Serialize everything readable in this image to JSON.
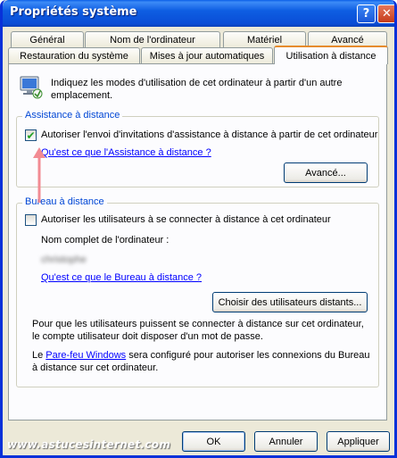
{
  "window": {
    "title": "Propriétés système",
    "help_label": "?",
    "close_label": "✕"
  },
  "tabs": {
    "row1": [
      "Général",
      "Nom de l'ordinateur",
      "Matériel",
      "Avancé"
    ],
    "row2": [
      "Restauration du système",
      "Mises à jour automatiques",
      "Utilisation à distance"
    ],
    "active": "Utilisation à distance"
  },
  "intro": {
    "text": "Indiquez les modes d'utilisation de cet ordinateur à partir d'un autre emplacement.",
    "icon": "remote-computer-icon"
  },
  "assistance": {
    "group_title": "Assistance à distance",
    "checkbox_label": "Autoriser l'envoi d'invitations d'assistance à distance à partir de cet ordinateur",
    "checked": true,
    "help_link": "Qu'est ce que l'Assistance à distance ?",
    "advanced_button": "Avancé..."
  },
  "bureau": {
    "group_title": "Bureau à distance",
    "checkbox_label": "Autoriser les utilisateurs à se connecter à distance à cet ordinateur",
    "checked": false,
    "computer_name_label": "Nom complet de l'ordinateur :",
    "computer_name_value": "christophe",
    "help_link": "Qu'est ce que le Bureau à distance ?",
    "select_users_button": "Choisir des utilisateurs distants...",
    "note1": "Pour que les utilisateurs puissent se connecter à distance sur cet ordinateur, le compte utilisateur doit disposer d'un mot de passe.",
    "note2_prefix": "Le ",
    "note2_link": "Pare-feu Windows",
    "note2_suffix": " sera configuré pour autoriser les connexions du Bureau à distance sur cet ordinateur."
  },
  "footer": {
    "ok": "OK",
    "cancel": "Annuler",
    "apply": "Appliquer",
    "watermark": "www.astucesinternet.com"
  },
  "colors": {
    "title_bar": "#0a4dd6",
    "group_title": "#0046d5",
    "link": "#0000ff",
    "annotation_arrow": "#f28b93"
  }
}
